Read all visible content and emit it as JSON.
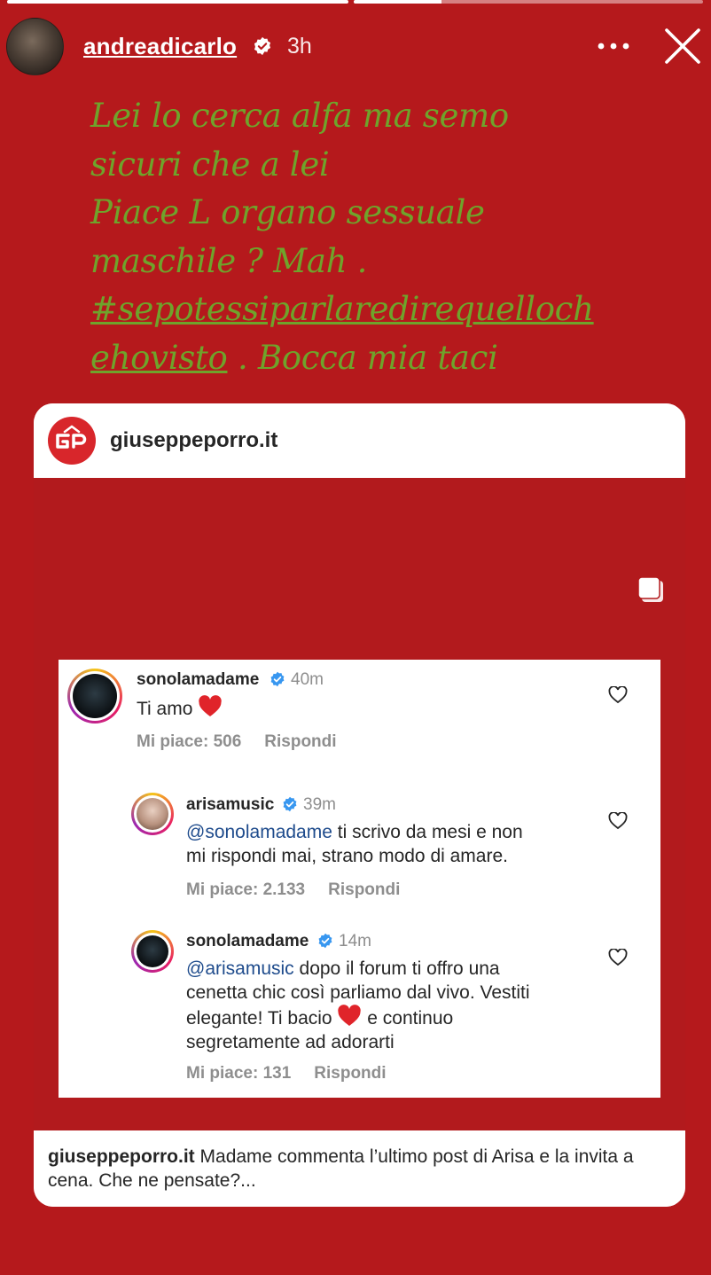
{
  "story": {
    "progress": [
      1.0,
      0.25
    ],
    "username": "andreadicarlo",
    "time": "3h",
    "colors": {
      "background": "#b5191c",
      "caption": "#6fa32b"
    },
    "caption_lines": [
      "Lei lo cerca alfa ma semo",
      "sicuri che a lei",
      "Piace L organo sessuale",
      "maschile ? Mah ."
    ],
    "caption_tag_line1": "#sepotessiparlaredirequelloch",
    "caption_tag_line2": "ehovisto",
    "caption_tail": " . Bocca mia taci"
  },
  "card": {
    "handle": "giuseppeporro.it",
    "footer_handle": "giuseppeporro.it",
    "footer_text": " Madame commenta l’ultimo post di Arisa e la invita a cena. Che ne pensate?..."
  },
  "comments": [
    {
      "user": "sonolamadame",
      "time": "40m",
      "text": "Ti amo",
      "likes": "Mi piace: 506",
      "reply": "Rispondi"
    },
    {
      "user": "arisamusic",
      "time": "39m",
      "mention": "@sonolamadame",
      "text_line1": " ti scrivo da mesi e non",
      "text_line2": "mi rispondi mai, strano modo di amare.",
      "likes": "Mi piace: 2.133",
      "reply": "Rispondi"
    },
    {
      "user": "sonolamadame",
      "time": "14m",
      "mention": "@arisamusic",
      "text_line1": " dopo il forum ti offro una",
      "text_line2": "cenetta chic così parliamo dal vivo. Vestiti",
      "text_line3a": "elegante! Ti bacio ",
      "text_line3b": " e continuo",
      "text_line4": "segretamente ad adorarti",
      "likes": "Mi piace: 131",
      "reply": "Rispondi"
    }
  ]
}
